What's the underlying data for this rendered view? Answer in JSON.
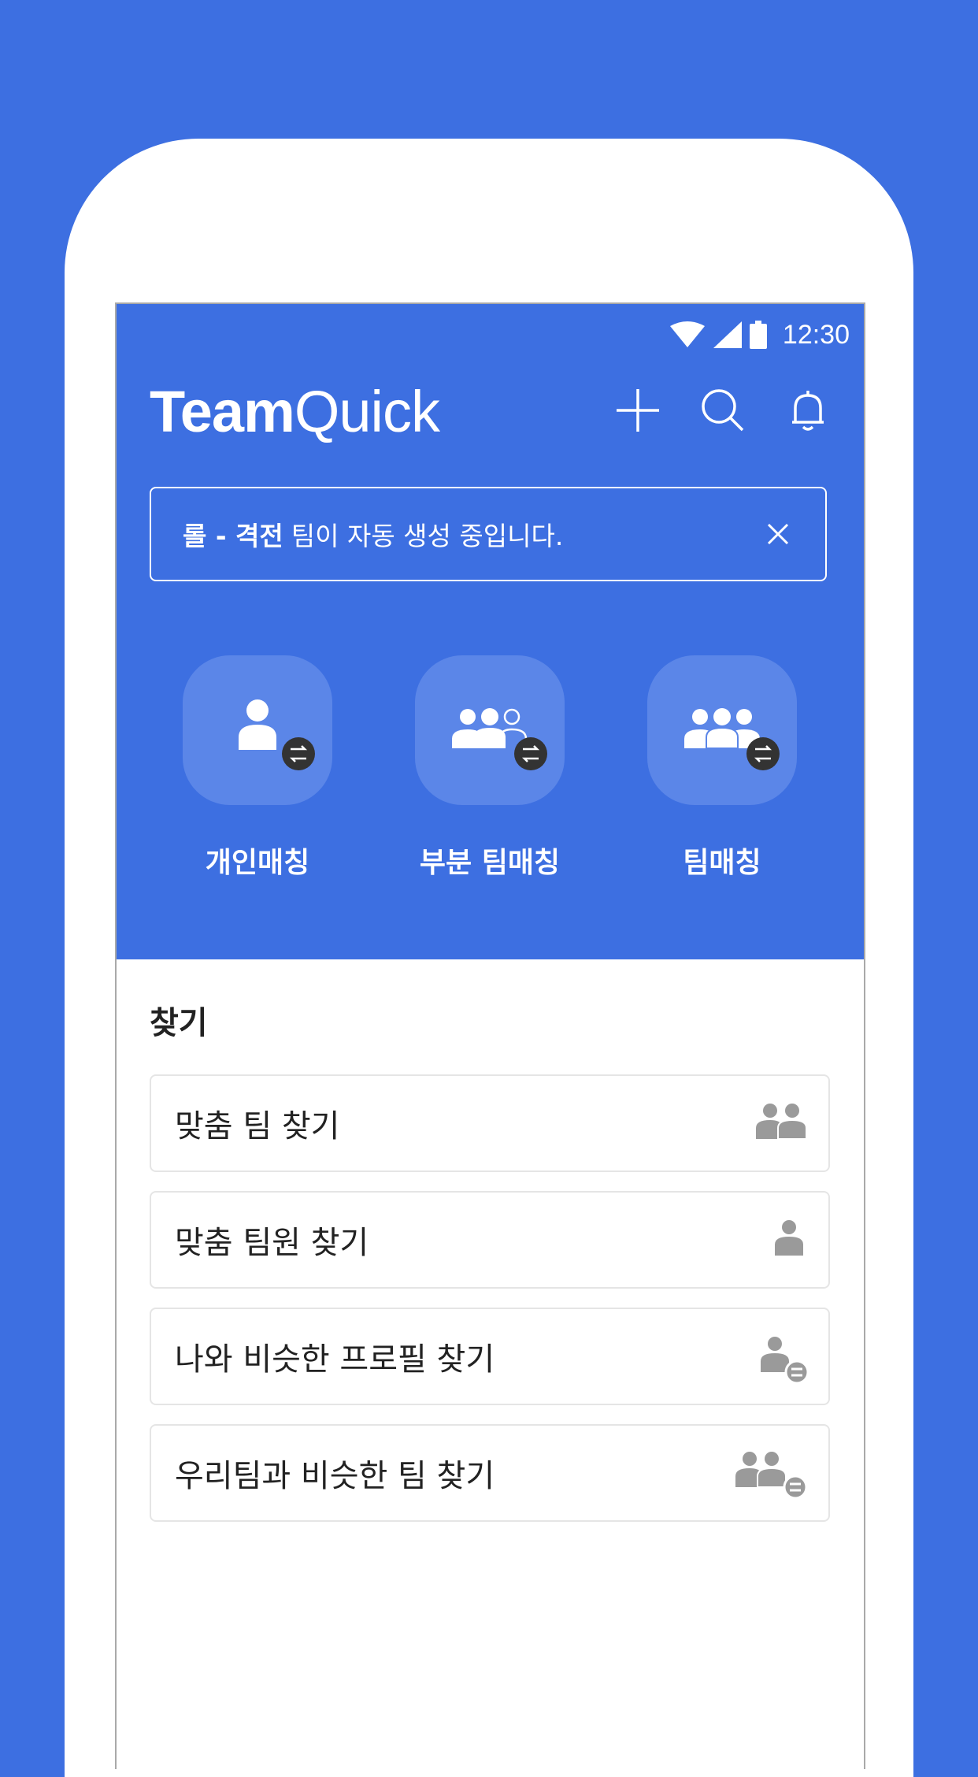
{
  "status_bar": {
    "time": "12:30"
  },
  "header": {
    "logo_bold": "Team",
    "logo_light": "Quick",
    "icons": [
      "plus-icon",
      "search-icon",
      "bell-icon"
    ]
  },
  "banner": {
    "highlight": "롤 - 격전",
    "text": "팀이 자동 생성 중입니다."
  },
  "matching": [
    {
      "label": "개인매칭",
      "icon": "person-swap-icon"
    },
    {
      "label": "부분 팀매칭",
      "icon": "partial-team-swap-icon"
    },
    {
      "label": "팀매칭",
      "icon": "team-swap-icon"
    }
  ],
  "find": {
    "title": "찾기",
    "items": [
      {
        "label": "맞춤 팀 찾기",
        "icon": "two-people-icon"
      },
      {
        "label": "맞춤 팀원 찾기",
        "icon": "person-icon"
      },
      {
        "label": "나와 비슷한 프로필 찾기",
        "icon": "person-equal-icon"
      },
      {
        "label": "우리팀과 비슷한 팀 찾기",
        "icon": "team-equal-icon"
      }
    ]
  },
  "colors": {
    "brand": "#3d6fe1",
    "tile": "#5b86e8",
    "icon_gray": "#9a9a9a"
  }
}
